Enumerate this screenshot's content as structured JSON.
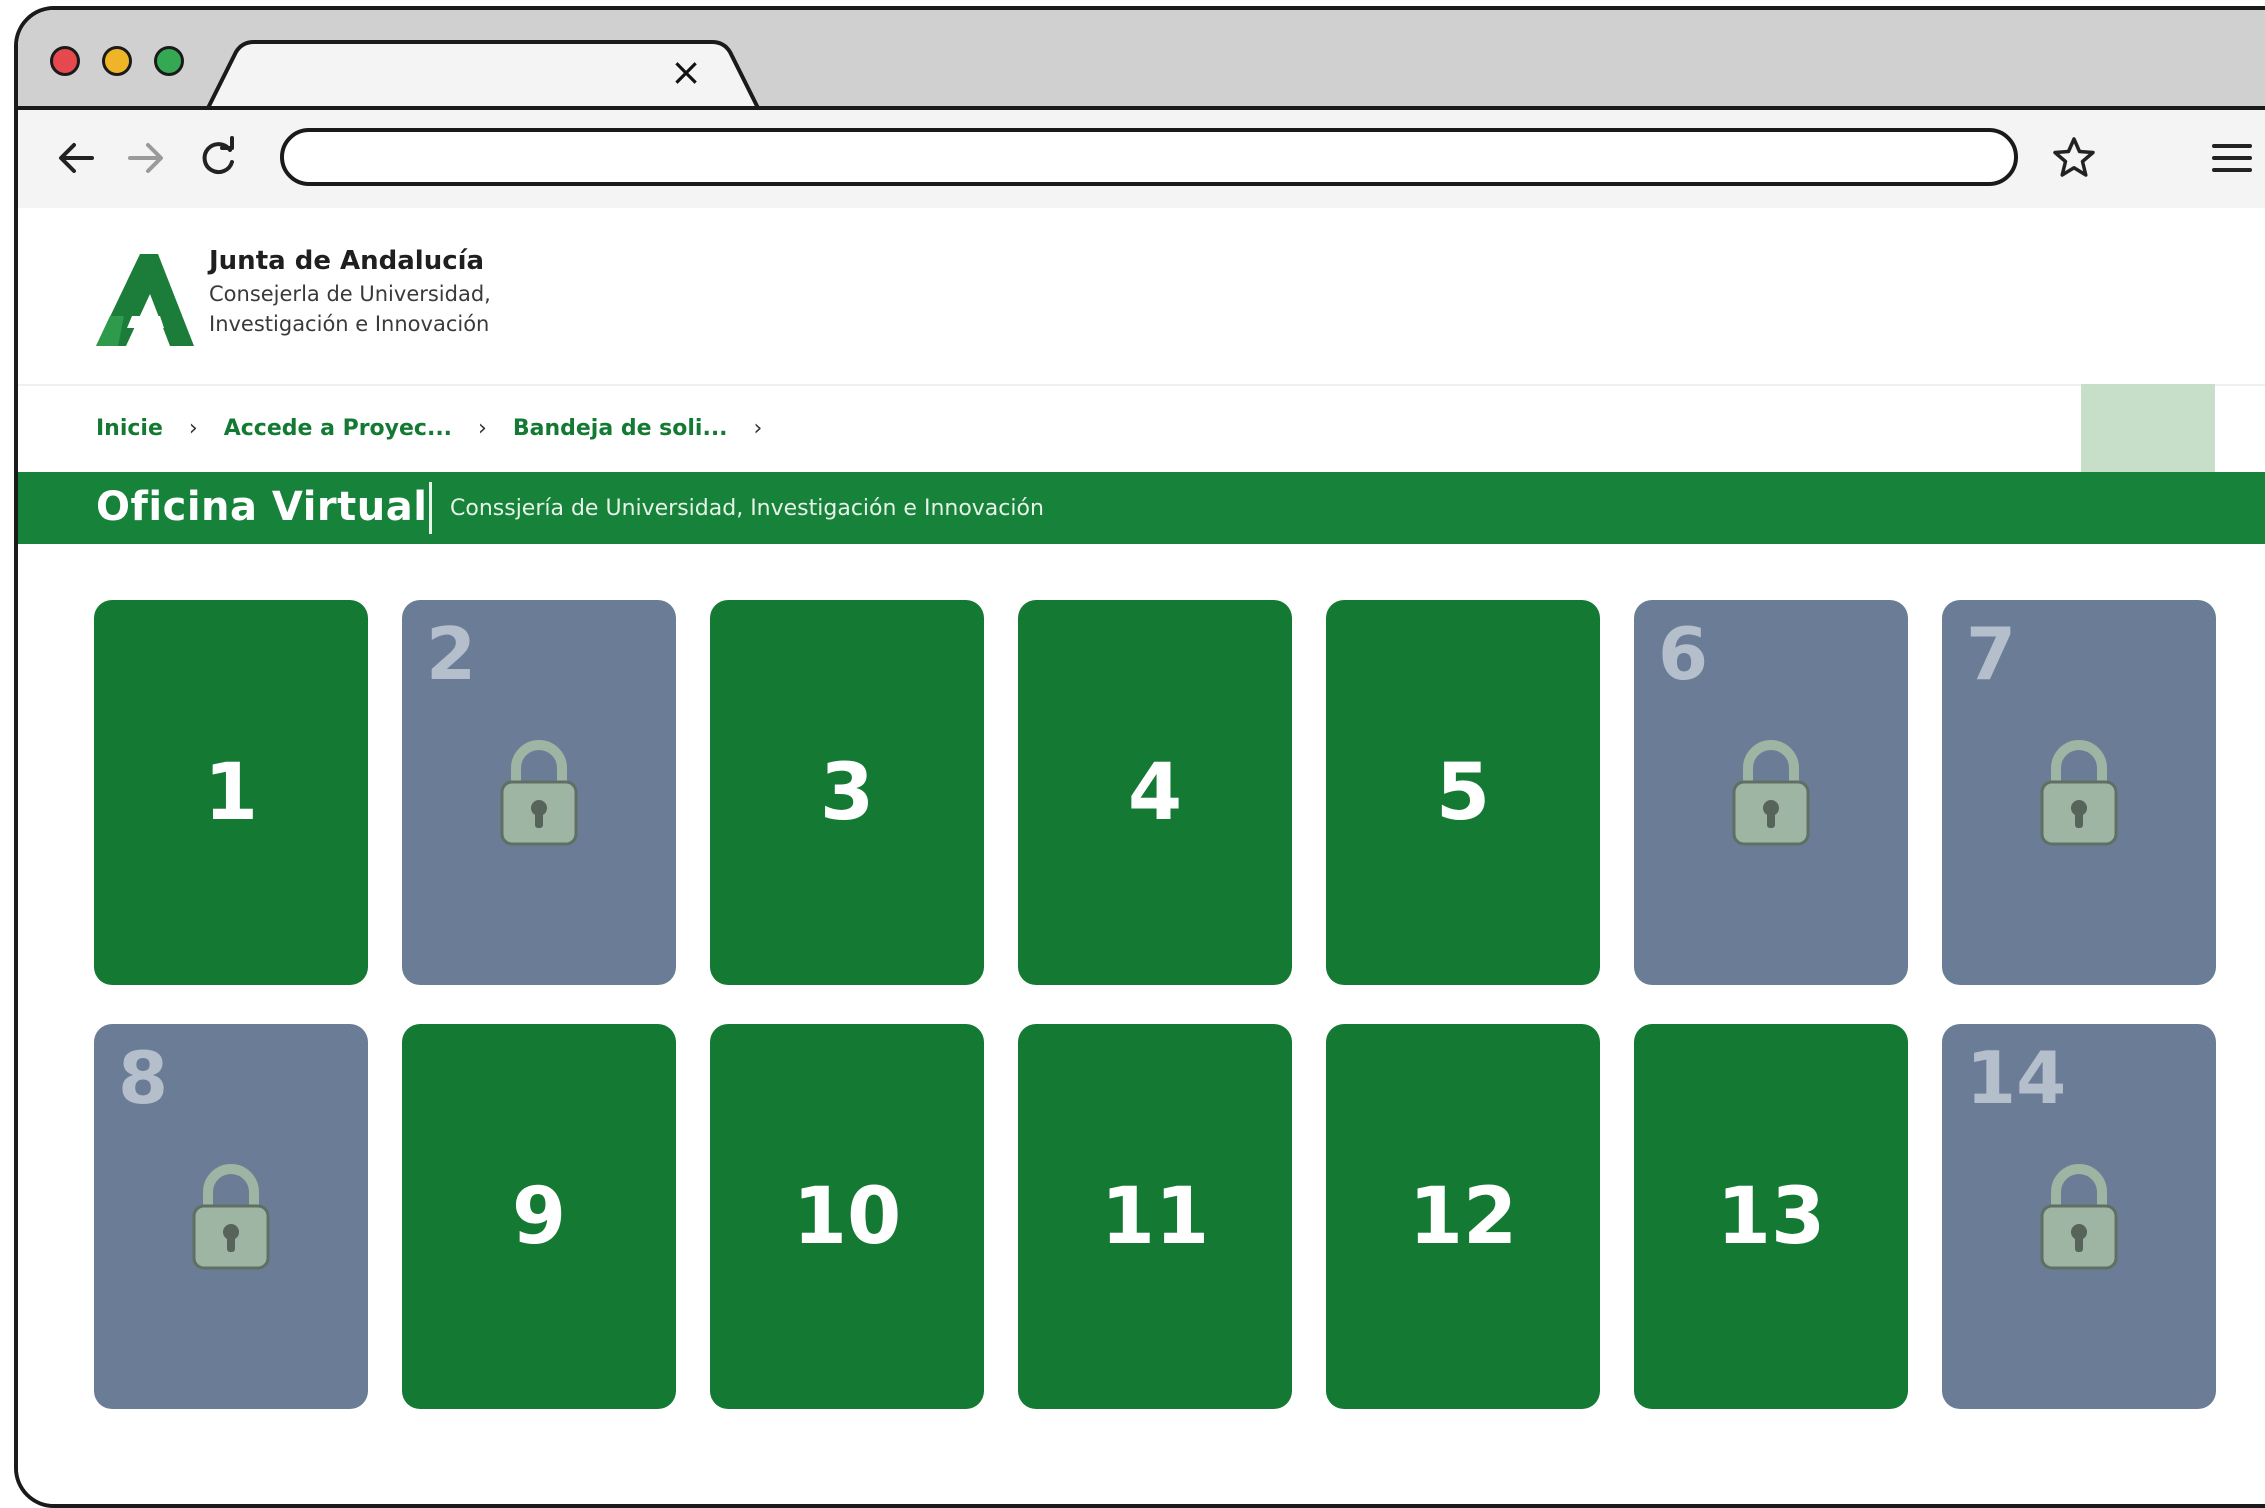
{
  "browser": {
    "tab_close": "×",
    "url": ""
  },
  "header": {
    "org_title": "Junta de Andalucía",
    "org_sub_line1": "Consejerla de Universidad,",
    "org_sub_line2": "Investigación e Innovación"
  },
  "breadcrumb": {
    "items": [
      "Inicie",
      "Accede a Proyec...",
      "Bandeja de soli..."
    ],
    "separator": "›"
  },
  "banner": {
    "title": "Oficina Virtual",
    "subtitle": "Conssjería de Universidad, Investigación e Innovación"
  },
  "tiles": [
    {
      "label": "1",
      "locked": false
    },
    {
      "label": "2",
      "locked": true
    },
    {
      "label": "3",
      "locked": false
    },
    {
      "label": "4",
      "locked": false
    },
    {
      "label": "5",
      "locked": false
    },
    {
      "label": "6",
      "locked": true
    },
    {
      "label": "7",
      "locked": true
    },
    {
      "label": "8",
      "locked": true
    },
    {
      "label": "9",
      "locked": false
    },
    {
      "label": "10",
      "locked": false
    },
    {
      "label": "11",
      "locked": false
    },
    {
      "label": "12",
      "locked": false
    },
    {
      "label": "13",
      "locked": false
    },
    {
      "label": "14",
      "locked": true
    }
  ],
  "colors": {
    "brand_green": "#147a33",
    "locked_tile": "#6b7d96",
    "lock_icon": "#9fb5a3"
  }
}
